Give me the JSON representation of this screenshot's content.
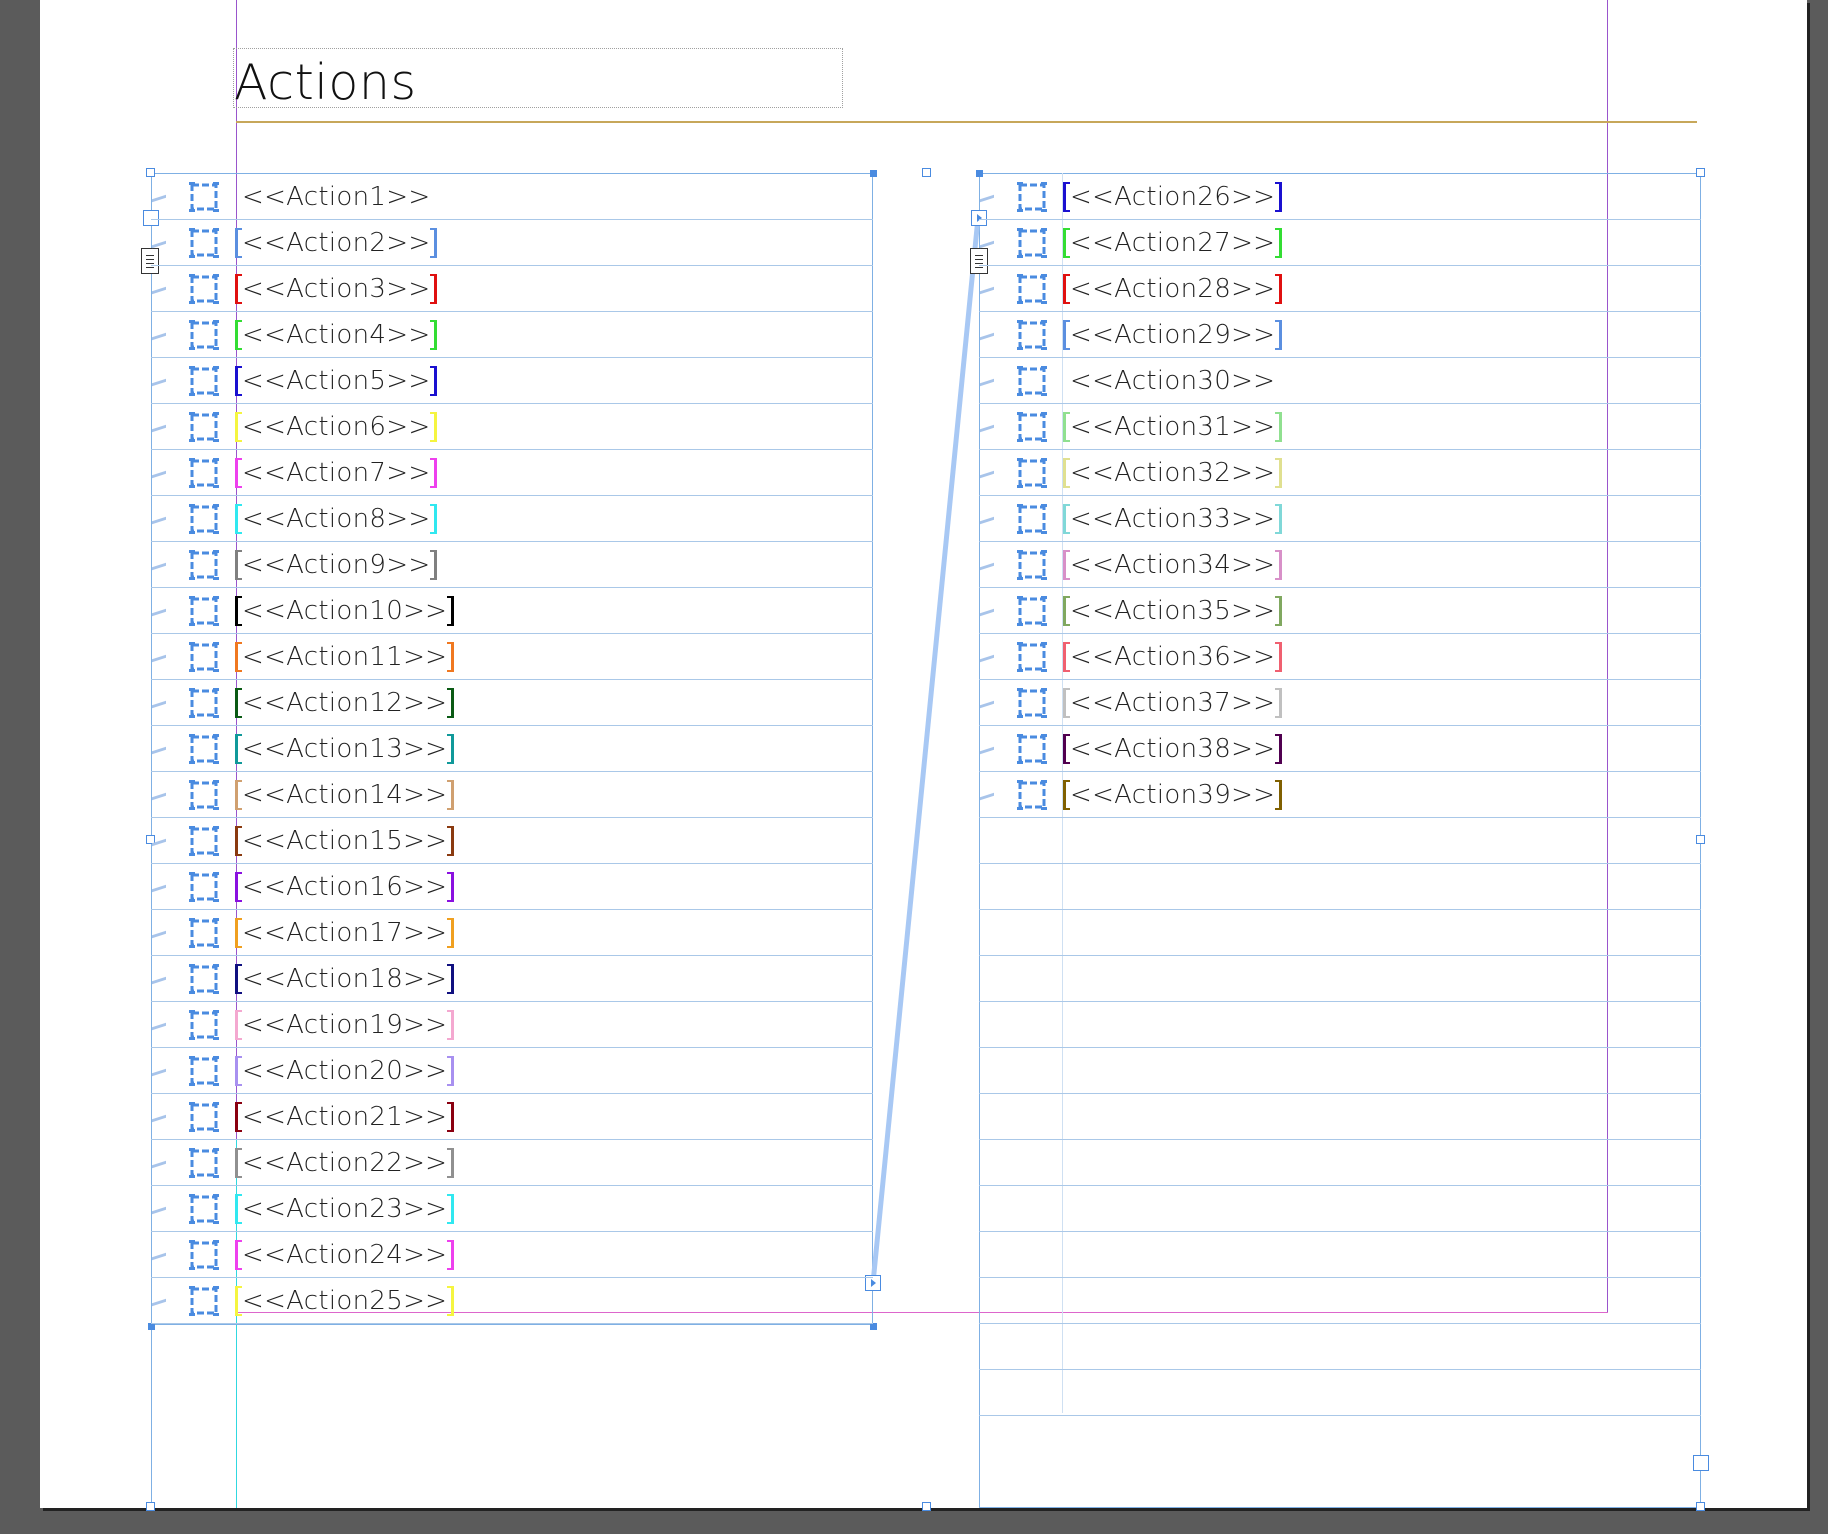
{
  "title": "Actions",
  "left_column": [
    {
      "label": "<<Action1>>",
      "color": ""
    },
    {
      "label": "<<Action2>>",
      "color": "#5b8fe0"
    },
    {
      "label": "<<Action3>>",
      "color": "#e01010"
    },
    {
      "label": "<<Action4>>",
      "color": "#33dd33"
    },
    {
      "label": "<<Action5>>",
      "color": "#1a10d0"
    },
    {
      "label": "<<Action6>>",
      "color": "#f5f540"
    },
    {
      "label": "<<Action7>>",
      "color": "#ee40ee"
    },
    {
      "label": "<<Action8>>",
      "color": "#30e8f0"
    },
    {
      "label": "<<Action9>>",
      "color": "#808080"
    },
    {
      "label": "<<Action10>>",
      "color": "#000000"
    },
    {
      "label": "<<Action11>>",
      "color": "#f07820"
    },
    {
      "label": "<<Action12>>",
      "color": "#0a5a14"
    },
    {
      "label": "<<Action13>>",
      "color": "#10999a"
    },
    {
      "label": "<<Action14>>",
      "color": "#d0a070"
    },
    {
      "label": "<<Action15>>",
      "color": "#8a3a10"
    },
    {
      "label": "<<Action16>>",
      "color": "#8a10e0"
    },
    {
      "label": "<<Action17>>",
      "color": "#f0a020"
    },
    {
      "label": "<<Action18>>",
      "color": "#101080"
    },
    {
      "label": "<<Action19>>",
      "color": "#f4a8d0"
    },
    {
      "label": "<<Action20>>",
      "color": "#a890f0"
    },
    {
      "label": "<<Action21>>",
      "color": "#8a0010"
    },
    {
      "label": "<<Action22>>",
      "color": "#909090"
    },
    {
      "label": "<<Action23>>",
      "color": "#30e8f0"
    },
    {
      "label": "<<Action24>>",
      "color": "#ee40ee"
    },
    {
      "label": "<<Action25>>",
      "color": "#f5f540"
    }
  ],
  "right_column": [
    {
      "label": "<<Action26>>",
      "color": "#1a10d0"
    },
    {
      "label": "<<Action27>>",
      "color": "#33dd33"
    },
    {
      "label": "<<Action28>>",
      "color": "#e01010"
    },
    {
      "label": "<<Action29>>",
      "color": "#5b8fe0"
    },
    {
      "label": "<<Action30>>",
      "color": ""
    },
    {
      "label": "<<Action31>>",
      "color": "#90e090"
    },
    {
      "label": "<<Action32>>",
      "color": "#e0e090"
    },
    {
      "label": "<<Action33>>",
      "color": "#80d8d8"
    },
    {
      "label": "<<Action34>>",
      "color": "#d890c8"
    },
    {
      "label": "<<Action35>>",
      "color": "#80a860"
    },
    {
      "label": "<<Action36>>",
      "color": "#f06070"
    },
    {
      "label": "<<Action37>>",
      "color": "#c0c0c0"
    },
    {
      "label": "<<Action38>>",
      "color": "#500050"
    },
    {
      "label": "<<Action39>>",
      "color": "#806000"
    }
  ]
}
